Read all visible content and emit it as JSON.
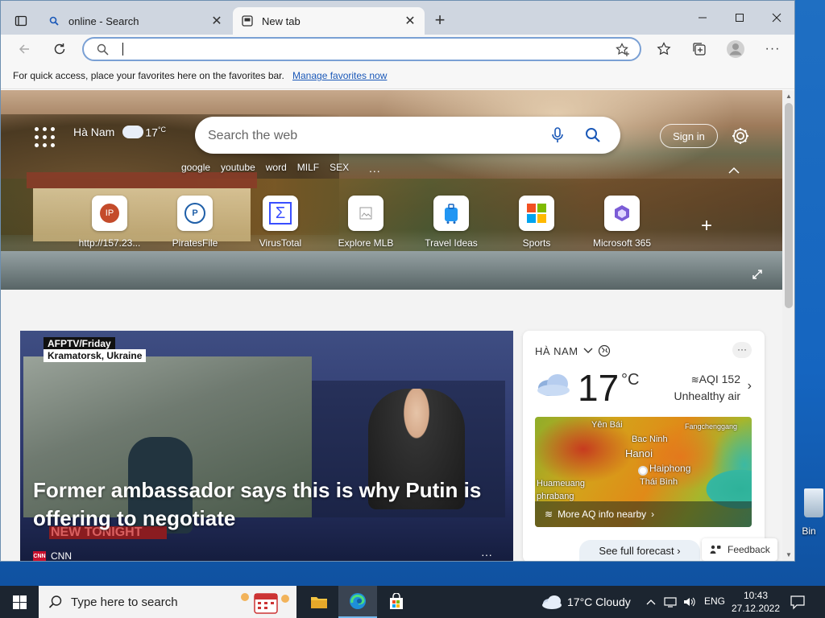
{
  "desktop": {
    "recycle_bin_label": "Bin"
  },
  "browser": {
    "tabs": [
      {
        "title": "online - Search",
        "icon": "search-icon"
      },
      {
        "title": "New tab",
        "icon": "newtab-icon"
      }
    ],
    "address": {
      "value": "",
      "placeholder": ""
    },
    "favorites_bar": {
      "text": "For quick access, place your favorites here on the favorites bar.",
      "link": "Manage favorites now"
    }
  },
  "newtab": {
    "location": "Hà Nam",
    "temperature": "17",
    "temp_unit": "°C",
    "search_placeholder": "Search the web",
    "sign_in": "Sign in",
    "trending": [
      "google",
      "youtube",
      "word",
      "MILF",
      "SEX"
    ],
    "trending_more": "...",
    "quick_links": [
      {
        "label": "http://157.23...",
        "icon_text": "IP",
        "icon_color": "#c44b2b"
      },
      {
        "label": "PiratesFile",
        "icon_text": "P",
        "icon_color": "#1f5fa8"
      },
      {
        "label": "VirusTotal",
        "icon_text": "Σ",
        "icon_color": "#394eff"
      },
      {
        "label": "Explore MLB",
        "icon_text": "",
        "icon_color": "#999999"
      },
      {
        "label": "Travel Ideas",
        "icon_text": "",
        "icon_color": "#2196f3"
      },
      {
        "label": "Sports",
        "icon_text": "",
        "icon_color": "#f25022"
      },
      {
        "label": "Microsoft 365",
        "icon_text": "",
        "icon_color": "#7b5cd6"
      }
    ],
    "add_link": "+"
  },
  "news": {
    "tag_line1": "AFPTV/Friday",
    "tag_line2": "Kramatorsk, Ukraine",
    "banner": "NEW TONIGHT",
    "headline": "Former ambassador says this is why Putin is offering to negotiate",
    "source": "CNN",
    "source_logo": "CNN",
    "more": "···"
  },
  "weather_card": {
    "location": "HÀ NAM",
    "temperature": "17",
    "unit": "°C",
    "aqi": "AQI 152",
    "aqi_status": "Unhealthy air",
    "map_cities": [
      {
        "name": "Yên Bái"
      },
      {
        "name": "Bac Ninh"
      },
      {
        "name": "Hanoi"
      },
      {
        "name": "Haiphong"
      },
      {
        "name": "Thái Bình"
      },
      {
        "name": "Huameuang"
      },
      {
        "name": "Fangchenggang"
      },
      {
        "name": "phrabang"
      }
    ],
    "aq_link": "More AQ info nearby",
    "forecast": "See full forecast",
    "more": "···"
  },
  "feedback": "Feedback",
  "taskbar": {
    "search_placeholder": "Type here to search",
    "weather": "17°C  Cloudy",
    "language": "ENG",
    "time": "10:43",
    "date": "27.12.2022"
  }
}
